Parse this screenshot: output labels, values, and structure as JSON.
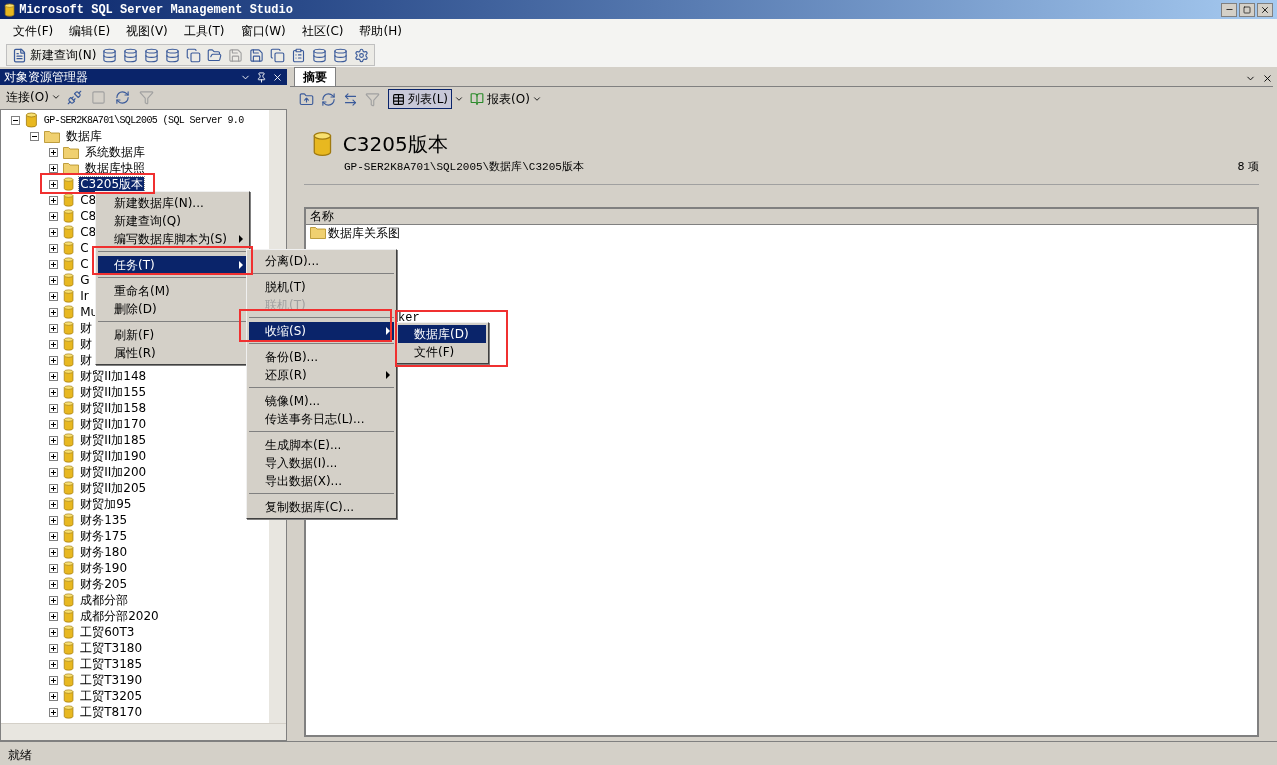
{
  "window": {
    "title": "Microsoft SQL Server Management Studio"
  },
  "menu_bar": [
    "文件(F)",
    "编辑(E)",
    "视图(V)",
    "工具(T)",
    "窗口(W)",
    "社区(C)",
    "帮助(H)"
  ],
  "toolbar": {
    "new_query": "新建查询(N)"
  },
  "object_explorer": {
    "title": "对象资源管理器",
    "connect": "连接(O)",
    "tree": [
      {
        "label": "GP-SER2K8A701\\SQL2005 (SQL Server 9.0",
        "kind": "server",
        "expanded": true,
        "selected": false,
        "children": [
          {
            "label": "数据库",
            "kind": "folder",
            "expanded": true,
            "selected": false,
            "children": [
              {
                "label": "系统数据库",
                "kind": "folder",
                "expanded": false,
                "selected": false
              },
              {
                "label": "数据库快照",
                "kind": "folder",
                "expanded": false,
                "selected": false
              },
              {
                "label": "C3205版本",
                "kind": "database",
                "expanded": false,
                "selected": true
              },
              {
                "label": "C8",
                "kind": "database",
                "expanded": false,
                "selected": false
              },
              {
                "label": "C8",
                "kind": "database",
                "expanded": false,
                "selected": false
              },
              {
                "label": "C8",
                "kind": "database",
                "expanded": false,
                "selected": false
              },
              {
                "label": "C",
                "kind": "database",
                "expanded": false,
                "selected": false
              },
              {
                "label": "C",
                "kind": "database",
                "expanded": false,
                "selected": false
              },
              {
                "label": "G",
                "kind": "database",
                "expanded": false,
                "selected": false
              },
              {
                "label": "Ir",
                "kind": "database",
                "expanded": false,
                "selected": false
              },
              {
                "label": "Mu",
                "kind": "database",
                "expanded": false,
                "selected": false
              },
              {
                "label": "财",
                "kind": "database",
                "expanded": false,
                "selected": false
              },
              {
                "label": "财",
                "kind": "database",
                "expanded": false,
                "selected": false
              },
              {
                "label": "财",
                "kind": "database",
                "expanded": false,
                "selected": false
              },
              {
                "label": "财贸II加148",
                "kind": "database",
                "expanded": false,
                "selected": false
              },
              {
                "label": "财贸II加155",
                "kind": "database",
                "expanded": false,
                "selected": false
              },
              {
                "label": "财贸II加158",
                "kind": "database",
                "expanded": false,
                "selected": false
              },
              {
                "label": "财贸II加170",
                "kind": "database",
                "expanded": false,
                "selected": false
              },
              {
                "label": "财贸II加185",
                "kind": "database",
                "expanded": false,
                "selected": false
              },
              {
                "label": "财贸II加190",
                "kind": "database",
                "expanded": false,
                "selected": false
              },
              {
                "label": "财贸II加200",
                "kind": "database",
                "expanded": false,
                "selected": false
              },
              {
                "label": "财贸II加205",
                "kind": "database",
                "expanded": false,
                "selected": false
              },
              {
                "label": "财贸加95",
                "kind": "database",
                "expanded": false,
                "selected": false
              },
              {
                "label": "财务135",
                "kind": "database",
                "expanded": false,
                "selected": false
              },
              {
                "label": "财务175",
                "kind": "database",
                "expanded": false,
                "selected": false
              },
              {
                "label": "财务180",
                "kind": "database",
                "expanded": false,
                "selected": false
              },
              {
                "label": "财务190",
                "kind": "database",
                "expanded": false,
                "selected": false
              },
              {
                "label": "财务205",
                "kind": "database",
                "expanded": false,
                "selected": false
              },
              {
                "label": "成都分部",
                "kind": "database",
                "expanded": false,
                "selected": false
              },
              {
                "label": "成都分部2020",
                "kind": "database",
                "expanded": false,
                "selected": false
              },
              {
                "label": "工贸60T3",
                "kind": "database",
                "expanded": false,
                "selected": false
              },
              {
                "label": "工贸T3180",
                "kind": "database",
                "expanded": false,
                "selected": false
              },
              {
                "label": "工贸T3185",
                "kind": "database",
                "expanded": false,
                "selected": false
              },
              {
                "label": "工贸T3190",
                "kind": "database",
                "expanded": false,
                "selected": false
              },
              {
                "label": "工贸T3205",
                "kind": "database",
                "expanded": false,
                "selected": false
              },
              {
                "label": "工贸T8170",
                "kind": "database",
                "expanded": false,
                "selected": false
              }
            ]
          }
        ]
      }
    ]
  },
  "summary": {
    "tab": "摘要",
    "list_view": {
      "label": "列表(L)",
      "selected": true
    },
    "report": "报表(O)",
    "title": "C3205版本",
    "path": "GP-SER2K8A701\\SQL2005\\数据库\\C3205版本",
    "count": "8 项",
    "column": "名称",
    "items": [
      {
        "label": "数据库关系图",
        "kind": "folder"
      },
      {
        "label": "ker",
        "kind": "partial"
      }
    ]
  },
  "context_menus": [
    {
      "items": [
        {
          "kind": "item",
          "label": "新建数据库(N)...",
          "selected": false,
          "disabled": false,
          "submenu": false
        },
        {
          "kind": "item",
          "label": "新建查询(Q)",
          "selected": false,
          "disabled": false,
          "submenu": false
        },
        {
          "kind": "item",
          "label": "编写数据库脚本为(S)",
          "selected": false,
          "disabled": false,
          "submenu": true
        },
        {
          "kind": "separator"
        },
        {
          "kind": "item",
          "label": "任务(T)",
          "selected": true,
          "disabled": false,
          "submenu": true
        },
        {
          "kind": "separator"
        },
        {
          "kind": "item",
          "label": "重命名(M)",
          "selected": false,
          "disabled": false,
          "submenu": false
        },
        {
          "kind": "item",
          "label": "删除(D)",
          "selected": false,
          "disabled": false,
          "submenu": false
        },
        {
          "kind": "separator"
        },
        {
          "kind": "item",
          "label": "刷新(F)",
          "selected": false,
          "disabled": false,
          "submenu": false
        },
        {
          "kind": "item",
          "label": "属性(R)",
          "selected": false,
          "disabled": false,
          "submenu": false
        }
      ]
    },
    {
      "items": [
        {
          "kind": "item",
          "label": "分离(D)...",
          "selected": false,
          "disabled": false,
          "submenu": false
        },
        {
          "kind": "separator"
        },
        {
          "kind": "item",
          "label": "脱机(T)",
          "selected": false,
          "disabled": false,
          "submenu": false
        },
        {
          "kind": "item",
          "label": "联机(T)",
          "selected": false,
          "disabled": true,
          "submenu": false
        },
        {
          "kind": "separator"
        },
        {
          "kind": "item",
          "label": "收缩(S)",
          "selected": true,
          "disabled": false,
          "submenu": true
        },
        {
          "kind": "separator"
        },
        {
          "kind": "item",
          "label": "备份(B)...",
          "selected": false,
          "disabled": false,
          "submenu": false
        },
        {
          "kind": "item",
          "label": "还原(R)",
          "selected": false,
          "disabled": false,
          "submenu": true
        },
        {
          "kind": "separator"
        },
        {
          "kind": "item",
          "label": "镜像(M)...",
          "selected": false,
          "disabled": false,
          "submenu": false
        },
        {
          "kind": "item",
          "label": "传送事务日志(L)...",
          "selected": false,
          "disabled": false,
          "submenu": false
        },
        {
          "kind": "separator"
        },
        {
          "kind": "item",
          "label": "生成脚本(E)...",
          "selected": false,
          "disabled": false,
          "submenu": false
        },
        {
          "kind": "item",
          "label": "导入数据(I)...",
          "selected": false,
          "disabled": false,
          "submenu": false
        },
        {
          "kind": "item",
          "label": "导出数据(X)...",
          "selected": false,
          "disabled": false,
          "submenu": false
        },
        {
          "kind": "separator"
        },
        {
          "kind": "item",
          "label": "复制数据库(C)...",
          "selected": false,
          "disabled": false,
          "submenu": false
        }
      ]
    },
    {
      "items": [
        {
          "kind": "item",
          "label": "数据库(D)",
          "selected": true,
          "disabled": false,
          "submenu": false
        },
        {
          "kind": "item",
          "label": "文件(F)",
          "selected": false,
          "disabled": false,
          "submenu": false
        }
      ]
    }
  ],
  "status_bar": "就绪"
}
